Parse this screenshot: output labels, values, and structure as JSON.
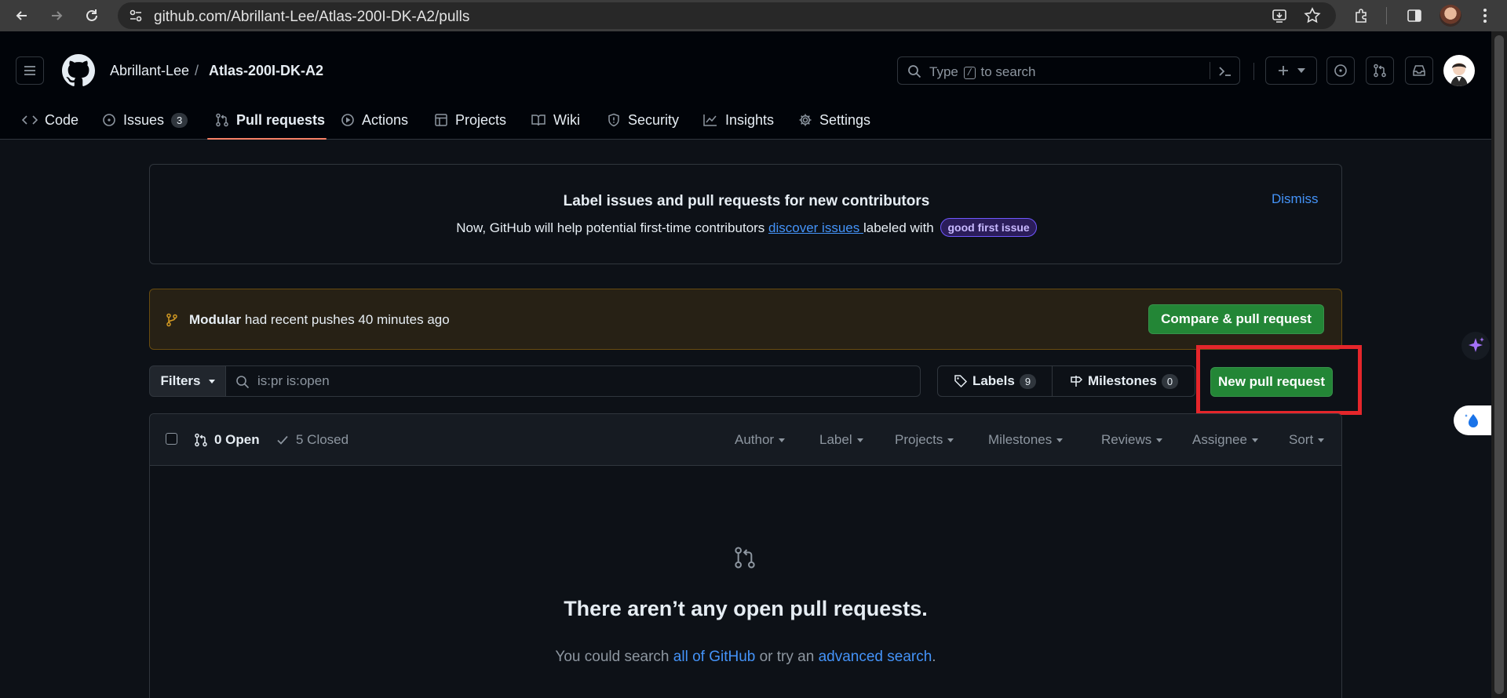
{
  "browser": {
    "url": "github.com/Abrillant-Lee/Atlas-200I-DK-A2/pulls"
  },
  "header": {
    "owner": "Abrillant-Lee",
    "separator": "/",
    "repo": "Atlas-200I-DK-A2",
    "search_placeholder_before": "Type",
    "search_key": "/",
    "search_placeholder_after": "to search"
  },
  "tabs": [
    {
      "label": "Code",
      "icon": "code-icon"
    },
    {
      "label": "Issues",
      "icon": "issue-icon",
      "counter": "3"
    },
    {
      "label": "Pull requests",
      "icon": "pull-request-icon",
      "selected": true
    },
    {
      "label": "Actions",
      "icon": "play-icon"
    },
    {
      "label": "Projects",
      "icon": "table-icon"
    },
    {
      "label": "Wiki",
      "icon": "book-icon"
    },
    {
      "label": "Security",
      "icon": "shield-icon"
    },
    {
      "label": "Insights",
      "icon": "graph-icon"
    },
    {
      "label": "Settings",
      "icon": "gear-icon"
    }
  ],
  "contrib_banner": {
    "title": "Label issues and pull requests for new contributors",
    "body_before": "Now, GitHub will help potential first-time contributors ",
    "link": "discover issues ",
    "body_after": "labeled with",
    "label": "good first issue",
    "dismiss": "Dismiss"
  },
  "push_banner": {
    "branch": "Modular",
    "text": " had recent pushes 40 minutes ago",
    "button": "Compare & pull request"
  },
  "filters": {
    "button": "Filters",
    "query": "is:pr is:open",
    "labels": "Labels",
    "labels_count": "9",
    "milestones": "Milestones",
    "milestones_count": "0",
    "new_pr": "New pull request"
  },
  "list": {
    "open": "0 Open",
    "closed": "5 Closed",
    "menus": [
      "Author",
      "Label",
      "Projects",
      "Milestones",
      "Reviews",
      "Assignee",
      "Sort"
    ]
  },
  "blankslate": {
    "title": "There aren’t any open pull requests.",
    "body_before": "You could search ",
    "link1": "all of GitHub",
    "body_middle": " or try an ",
    "link2": "advanced search",
    "body_after": "."
  },
  "colors": {
    "accent_green": "#238636",
    "link_blue": "#4493f8",
    "tab_underline": "#f78166",
    "highlight_red": "#e5262b"
  }
}
